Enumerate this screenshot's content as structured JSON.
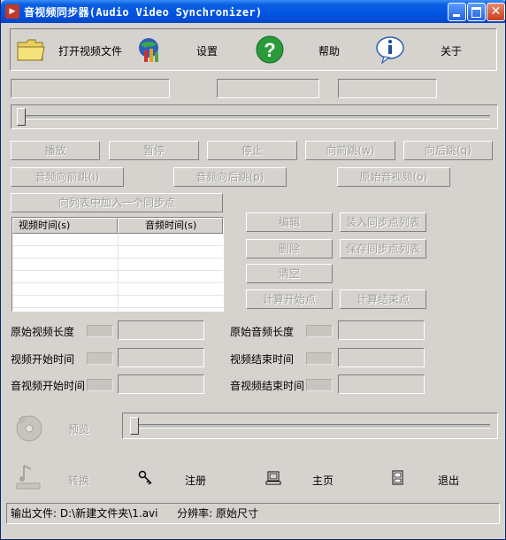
{
  "window": {
    "title": "音视频同步器(Audio Video Synchronizer)"
  },
  "toolbar": {
    "open_label": "打开视频文件",
    "settings_label": "设置",
    "help_label": "帮助",
    "about_label": "关于"
  },
  "playback": {
    "play": "播放",
    "pause": "暂停",
    "stop": "停止",
    "jump_forward": "向前跳(w)",
    "jump_back": "向后跳(q)",
    "audio_forward": "音频向前跳(i)",
    "audio_back": "音频向后跳(p)",
    "original_av": "原始音视频(o)",
    "add_sync_point": "向列表中加入一个同步点"
  },
  "sync_list": {
    "columns": [
      "视频时间(s)",
      "音频时间(s)"
    ],
    "rows": []
  },
  "list_actions": {
    "edit": "编辑",
    "load": "装入同步点列表",
    "delete": "删除",
    "save": "保存同步点列表",
    "clear": "清空",
    "calc_start": "计算开始点",
    "calc_end": "计算结束点"
  },
  "fields": {
    "orig_video_length": "原始视频长度",
    "orig_audio_length": "原始音频长度",
    "video_start_time": "视频开始时间",
    "video_end_time": "视频结束时间",
    "av_start_time": "音视频开始时间",
    "av_end_time": "音视频结束时间"
  },
  "bottom": {
    "preview_label": "预览",
    "convert_label": "转换",
    "register_label": "注册",
    "homepage_label": "主页",
    "exit_label": "退出"
  },
  "status": {
    "output_file_label": "输出文件:",
    "output_file_value": "D:\\新建文件夹\\1.avi",
    "resolution_label": "分辨率:",
    "resolution_value": "原始尺寸"
  }
}
